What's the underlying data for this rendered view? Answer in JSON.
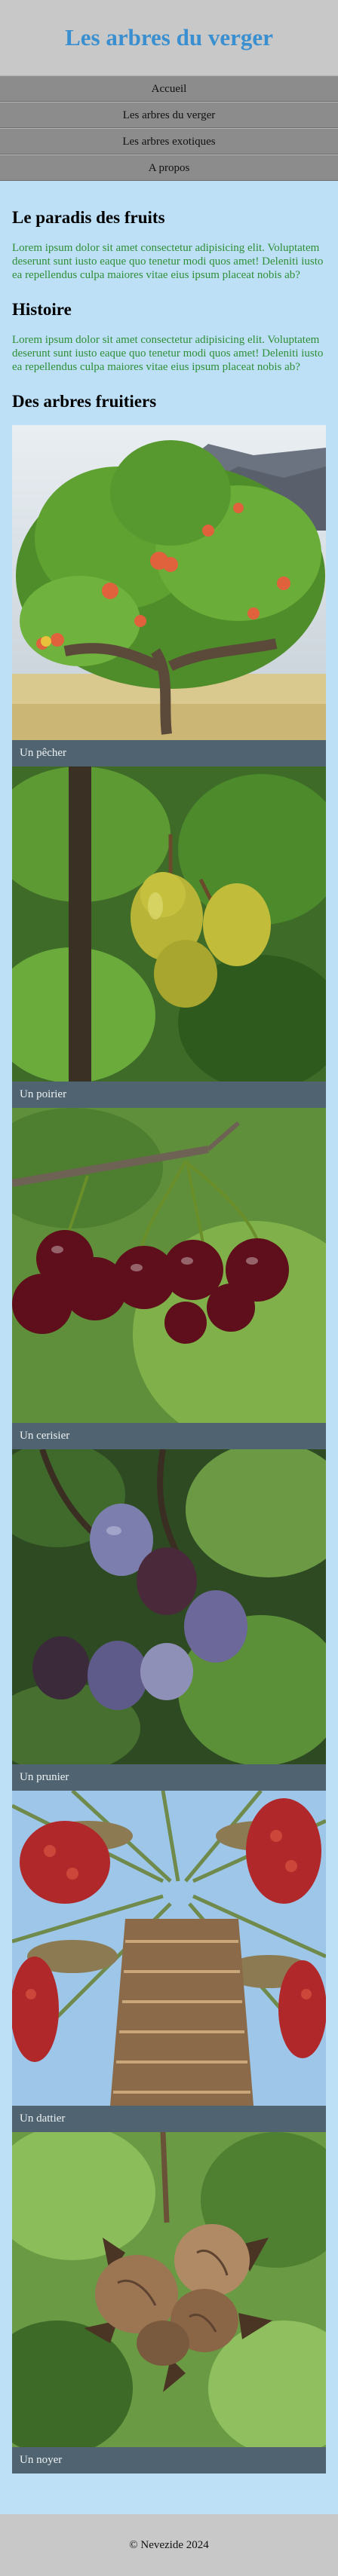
{
  "header": {
    "title": "Les arbres du verger"
  },
  "nav": {
    "items": [
      {
        "label": "Accueil"
      },
      {
        "label": "Les arbres du verger"
      },
      {
        "label": "Les arbres exotiques"
      },
      {
        "label": "A propos"
      }
    ]
  },
  "sections": [
    {
      "title": "Le paradis des fruits",
      "text": "Lorem ipsum dolor sit amet consectetur adipisicing elit. Voluptatem deserunt sunt iusto eaque quo tenetur modi quos amet! Deleniti iusto ea repellendus culpa maiores vitae eius ipsum placeat nobis ab?"
    },
    {
      "title": "Histoire",
      "text": "Lorem ipsum dolor sit amet consectetur adipisicing elit. Voluptatem deserunt sunt iusto eaque quo tenetur modi quos amet! Deleniti iusto ea repellendus culpa maiores vitae eius ipsum placeat nobis ab?"
    }
  ],
  "gallery": {
    "title": "Des arbres fruitiers",
    "items": [
      {
        "caption": "Un pêcher"
      },
      {
        "caption": "Un poirier"
      },
      {
        "caption": "Un cerisier"
      },
      {
        "caption": "Un prunier"
      },
      {
        "caption": "Un dattier"
      },
      {
        "caption": "Un noyer"
      }
    ]
  },
  "footer": {
    "text": "© Nevezide 2024"
  }
}
